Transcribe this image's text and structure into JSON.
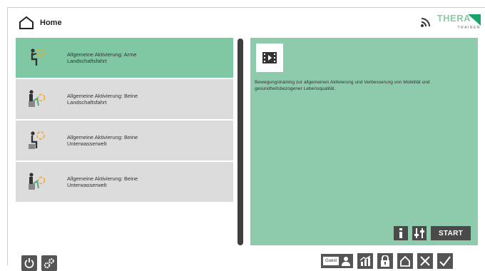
{
  "header": {
    "title": "Home"
  },
  "brand": {
    "name": "THERA",
    "subtitle": "TRAINER"
  },
  "programs": [
    {
      "line1": "Allgemeine Aktivierung: Arme",
      "line2": "Landschaftsfahrt",
      "selected": true
    },
    {
      "line1": "Allgemeine Aktivierung: Beine",
      "line2": "Landschaftsfahrt",
      "selected": false
    },
    {
      "line1": "Allgemeine Aktivierung: Beine",
      "line2": "Unterwasserwelt",
      "selected": false
    },
    {
      "line1": "Allgemeine Aktivierung: Beine",
      "line2": "Unterwasserwelt",
      "selected": false
    }
  ],
  "detail": {
    "description": "Bewegungstraining zur allgemeinen Aktivierung und Verbesserung von Mobilität und gesundheitsbezogener Lebensqualität.",
    "start_label": "START"
  },
  "footer": {
    "guest_label": "Guest"
  },
  "colors": {
    "accent": "#80c8a4",
    "panel": "#8ecbac",
    "dark": "#4a4a4a"
  }
}
